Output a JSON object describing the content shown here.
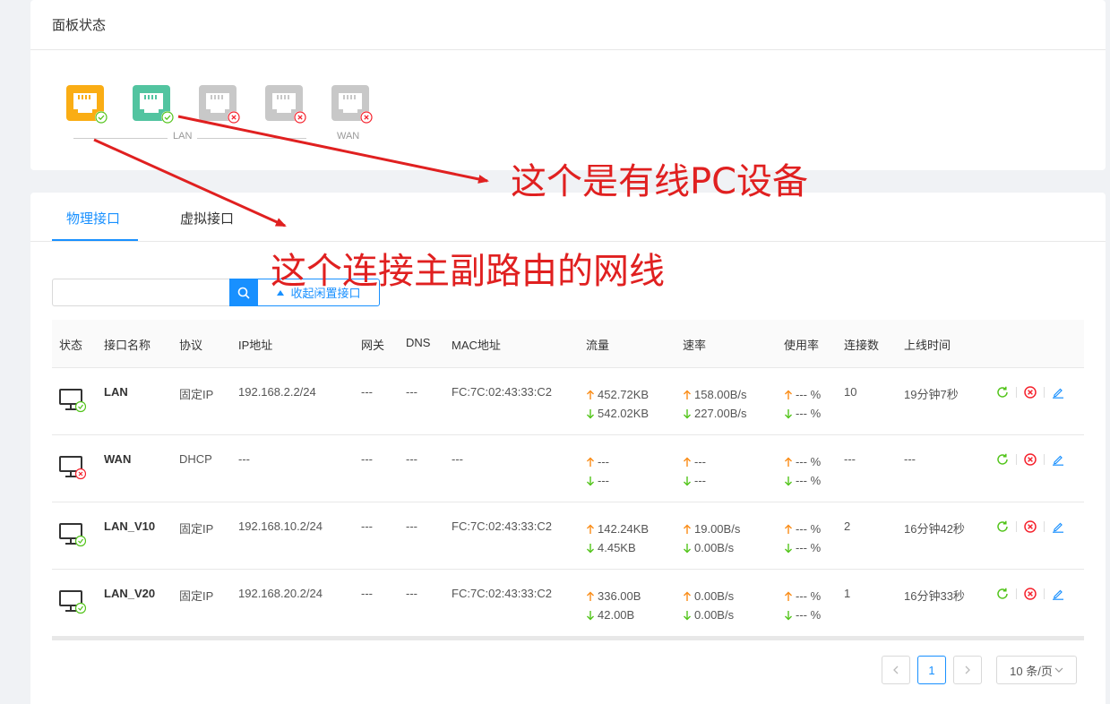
{
  "panel": {
    "title": "面板状态",
    "ports": [
      {
        "status": "up",
        "color": "#faad14"
      },
      {
        "status": "up",
        "color": "#52c4a0"
      },
      {
        "status": "down",
        "color": "#c8c8c8"
      },
      {
        "status": "down",
        "color": "#c8c8c8"
      },
      {
        "status": "down",
        "color": "#c8c8c8"
      }
    ],
    "lan_label": "LAN",
    "wan_label": "WAN"
  },
  "tabs": {
    "physical": "物理接口",
    "virtual": "虚拟接口"
  },
  "search": {
    "placeholder": "",
    "value": "",
    "collapse_label": "收起闲置接口"
  },
  "table": {
    "headers": {
      "status": "状态",
      "name": "接口名称",
      "protocol": "协议",
      "ip": "IP地址",
      "gateway": "网关",
      "dns": "DNS",
      "mac": "MAC地址",
      "traffic": "流量",
      "rate": "速率",
      "usage": "使用率",
      "connections": "连接数",
      "uptime": "上线时间"
    },
    "rows": [
      {
        "status": "up",
        "name": "LAN",
        "protocol": "固定IP",
        "ip": "192.168.2.2/24",
        "gateway": "---",
        "dns": "---",
        "mac": "FC:7C:02:43:33:C2",
        "traffic_up": "452.72KB",
        "traffic_down": "542.02KB",
        "rate_up": "158.00B/s",
        "rate_down": "227.00B/s",
        "usage_up": "--- %",
        "usage_down": "--- %",
        "connections": "10",
        "uptime": "19分钟7秒"
      },
      {
        "status": "down",
        "name": "WAN",
        "protocol": "DHCP",
        "ip": "---",
        "gateway": "---",
        "dns": "---",
        "mac": "---",
        "traffic_up": "---",
        "traffic_down": "---",
        "rate_up": "---",
        "rate_down": "---",
        "usage_up": "--- %",
        "usage_down": "--- %",
        "connections": "---",
        "uptime": "---"
      },
      {
        "status": "up",
        "name": "LAN_V10",
        "protocol": "固定IP",
        "ip": "192.168.10.2/24",
        "gateway": "---",
        "dns": "---",
        "mac": "FC:7C:02:43:33:C2",
        "traffic_up": "142.24KB",
        "traffic_down": "4.45KB",
        "rate_up": "19.00B/s",
        "rate_down": "0.00B/s",
        "usage_up": "--- %",
        "usage_down": "--- %",
        "connections": "2",
        "uptime": "16分钟42秒"
      },
      {
        "status": "up",
        "name": "LAN_V20",
        "protocol": "固定IP",
        "ip": "192.168.20.2/24",
        "gateway": "---",
        "dns": "---",
        "mac": "FC:7C:02:43:33:C2",
        "traffic_up": "336.00B",
        "traffic_down": "42.00B",
        "rate_up": "0.00B/s",
        "rate_down": "0.00B/s",
        "usage_up": "--- %",
        "usage_down": "--- %",
        "connections": "1",
        "uptime": "16分钟33秒"
      }
    ]
  },
  "pagination": {
    "current_page": "1",
    "page_size": "10 条/页"
  },
  "annotations": {
    "pc_device": "这个是有线PC设备",
    "cable": "这个连接主副路由的网线"
  },
  "colors": {
    "accent": "#1890ff",
    "success": "#52c41a",
    "danger": "#f5222d",
    "upload": "#fa8c16",
    "annotation": "#e02020"
  }
}
